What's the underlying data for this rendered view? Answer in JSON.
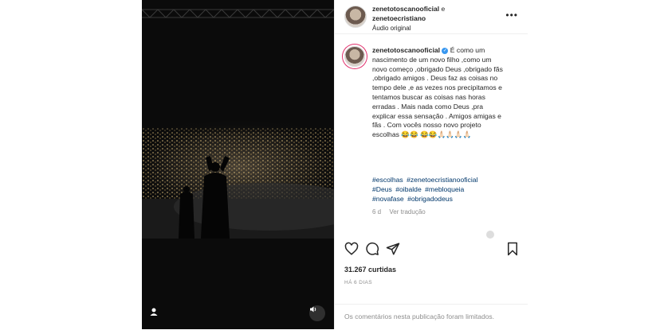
{
  "header": {
    "user1": "zenetotoscanooficial",
    "connector": "e",
    "user2": "zenetoecristiano",
    "audio": "Áudio original",
    "more": "•••"
  },
  "caption": {
    "username": "zenetotoscanooficial",
    "text": "É como um nascimento de um novo filho ,como um novo começo ,obrigado Deus ,obrigado fãs ,obrigado amigos . Deus faz as coisas no tempo dele ,e as vezes nos precipitamos e tentamos buscar as coisas nas horas erradas . Mais nada como Deus ,pra explicar essa sensação . Amigos amigas e fãs . Com vocês nosso novo projeto escolhas 😂😂 😂😂🙏🏻🙏🏻🙏🏻🙏🏻",
    "hashtags": [
      "#escolhas",
      "#zenetoecristianooficial",
      "#Deus",
      "#oibalde",
      "#mebloqueia",
      "#novafase",
      "#obrigadodeus"
    ],
    "age": "6 d",
    "translate": "Ver tradução"
  },
  "stats": {
    "likes": "31.267 curtidas",
    "date": "HÁ 6 DIAS"
  },
  "footer": {
    "comments_limited": "Os comentários nesta publicação foram limitados."
  },
  "icons": {
    "like": "heart-icon",
    "comment": "comment-icon",
    "share": "send-icon",
    "save": "bookmark-icon",
    "tag": "user-icon",
    "audio": "speaker-icon",
    "verified": "verified-icon"
  }
}
